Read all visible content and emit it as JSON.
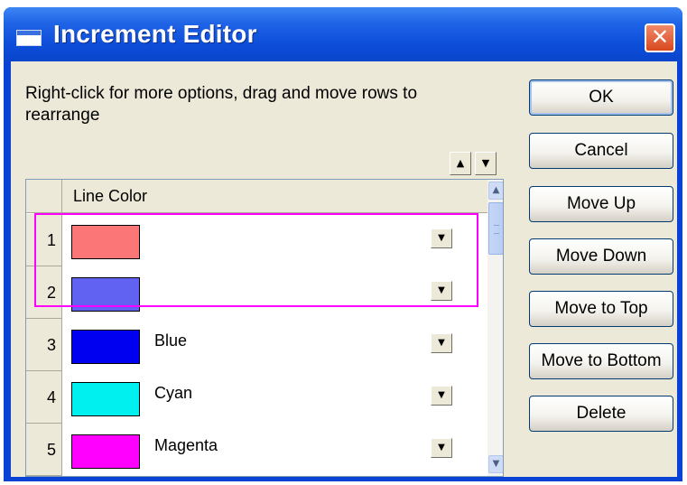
{
  "window": {
    "title": "Increment Editor",
    "close_glyph": "✕"
  },
  "instructions": "Right-click for more options, drag and move rows to  rearrange",
  "grid": {
    "column_header": "Line Color",
    "rows": [
      {
        "num": "1",
        "color": "#fb7777",
        "name": ""
      },
      {
        "num": "2",
        "color": "#6262f2",
        "name": ""
      },
      {
        "num": "3",
        "color": "#0000f0",
        "name": "Blue"
      },
      {
        "num": "4",
        "color": "#00f0f0",
        "name": "Cyan"
      },
      {
        "num": "5",
        "color": "#ff00ff",
        "name": "Magenta"
      }
    ]
  },
  "buttons": {
    "ok": "OK",
    "cancel": "Cancel",
    "move_up": "Move Up",
    "move_down": "Move Down",
    "move_to_top": "Move to Top",
    "move_to_bottom": "Move to Bottom",
    "delete": "Delete"
  },
  "icons": {
    "arrow_up": "▲",
    "arrow_down": "▼",
    "dropdown": "▼"
  },
  "highlight_color": "#ff00ff"
}
